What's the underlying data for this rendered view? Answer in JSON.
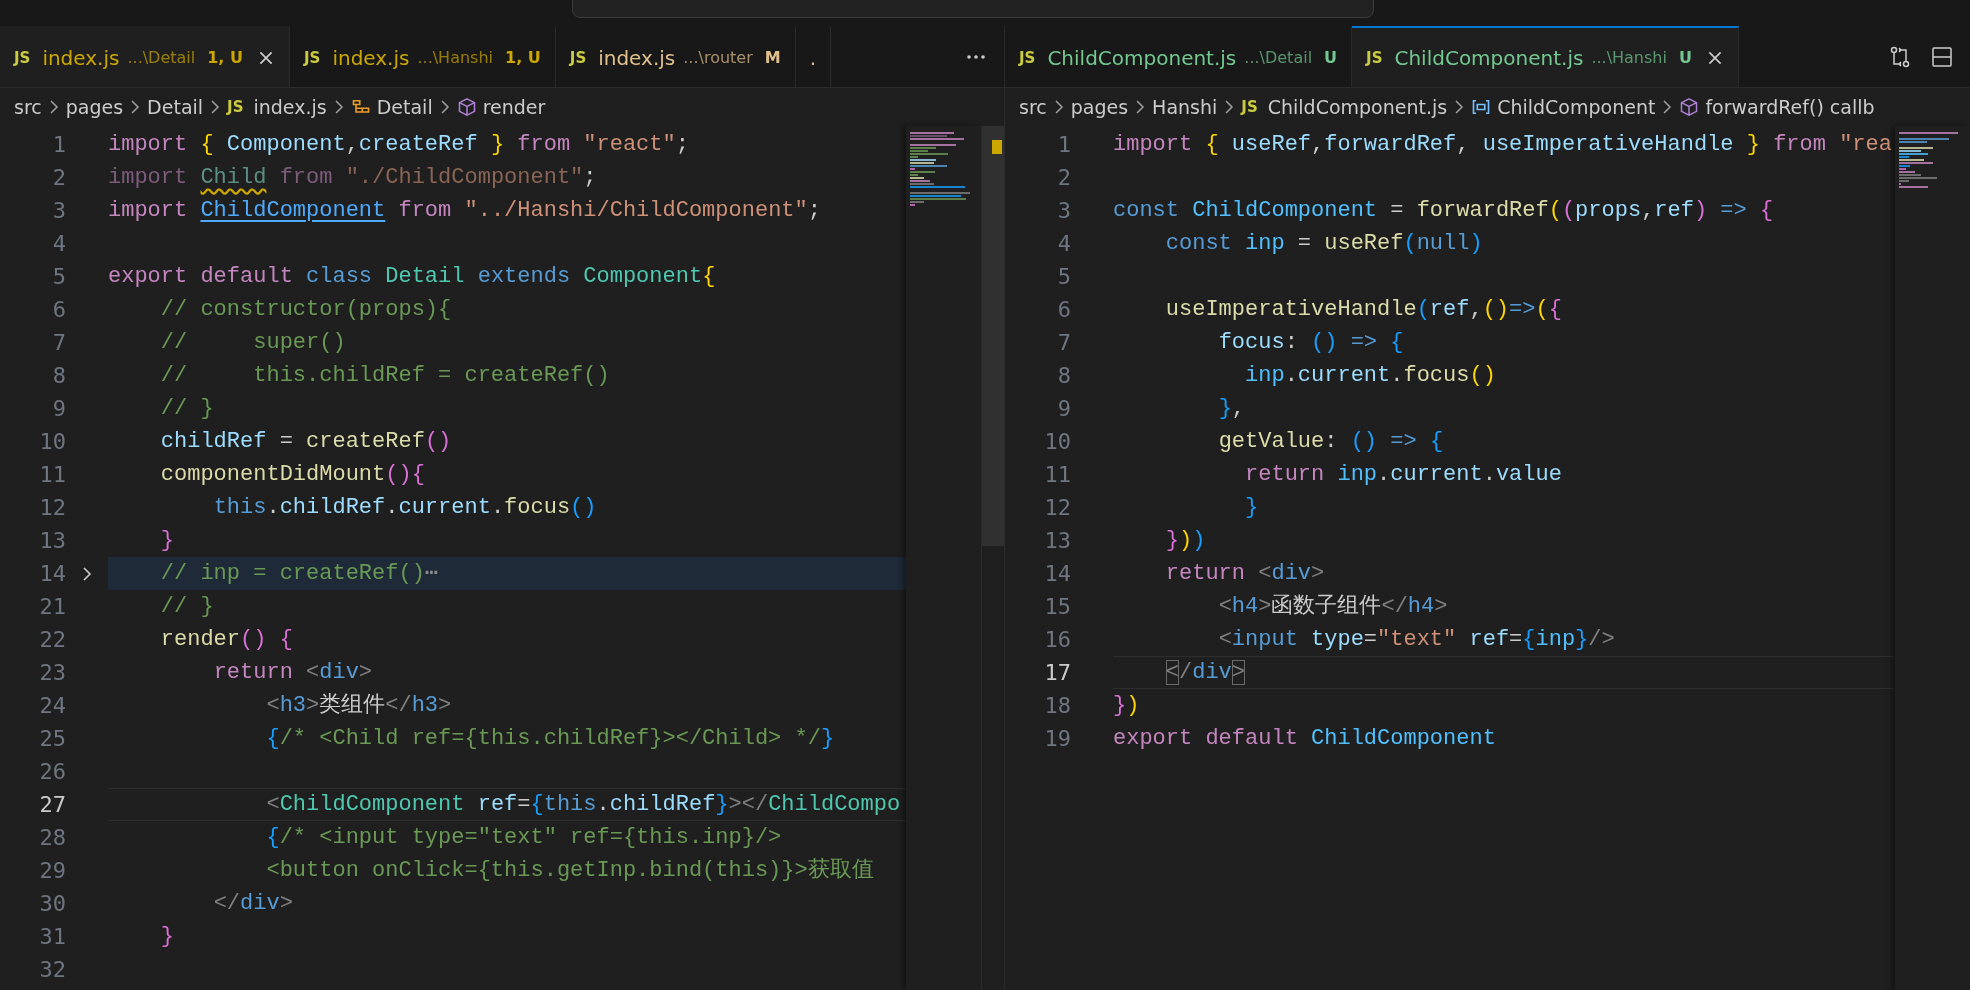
{
  "editor_groups": [
    {
      "focused": false,
      "tabs": [
        {
          "badge": "JS",
          "label": "index.js",
          "description": "...\\Detail",
          "status": "1, U",
          "kind": "warning",
          "selected": true
        },
        {
          "badge": "JS",
          "label": "index.js",
          "description": "...\\Hanshi",
          "status": "1, U",
          "kind": "warning",
          "selected": false
        },
        {
          "badge": "JS",
          "label": "index.js",
          "description": "...\\router",
          "status": "M",
          "kind": "modified",
          "selected": false
        },
        {
          "label": ".",
          "kind": "modified",
          "selected": false
        }
      ],
      "breadcrumbs": [
        {
          "kind": "folder",
          "label": "src"
        },
        {
          "kind": "folder",
          "label": "pages"
        },
        {
          "kind": "folder",
          "label": "Detail"
        },
        {
          "kind": "file",
          "badge": "JS",
          "label": "index.js"
        },
        {
          "kind": "class",
          "label": "Detail"
        },
        {
          "kind": "method",
          "label": "render"
        }
      ],
      "lines": [
        {
          "number": "1",
          "current": false,
          "folded": false,
          "tokens": [
            {
              "kind": "kw",
              "text": "import "
            },
            {
              "kind": "b1",
              "text": "{ "
            },
            {
              "kind": "va",
              "text": "Component"
            },
            {
              "kind": "p",
              "text": ","
            },
            {
              "kind": "va",
              "text": "createRef "
            },
            {
              "kind": "b1",
              "text": "} "
            },
            {
              "kind": "kw",
              "text": "from "
            },
            {
              "kind": "str",
              "text": "\"react\""
            },
            {
              "kind": "p",
              "text": ";"
            }
          ]
        },
        {
          "number": "2",
          "current": false,
          "folded": false,
          "tokens": [
            {
              "kind": "kw_dim",
              "text": "import "
            },
            {
              "kind": "ty_warn",
              "text": "Child"
            },
            {
              "kind": "kw_dim",
              "text": " from "
            },
            {
              "kind": "str_dim",
              "text": "\"./ChildComponent\""
            },
            {
              "kind": "p",
              "text": ";"
            }
          ]
        },
        {
          "number": "3",
          "current": false,
          "folded": false,
          "tokens": [
            {
              "kind": "kw",
              "text": "import "
            },
            {
              "kind": "link",
              "text": "ChildComponent"
            },
            {
              "kind": "kw",
              "text": " from "
            },
            {
              "kind": "str",
              "text": "\"../Hanshi/ChildComponent\""
            },
            {
              "kind": "p",
              "text": ";"
            }
          ]
        },
        {
          "number": "4",
          "current": false,
          "folded": false
        },
        {
          "number": "5",
          "current": false,
          "folded": false,
          "tokens": [
            {
              "kind": "kw",
              "text": "export default "
            },
            {
              "kind": "st",
              "text": "class "
            },
            {
              "kind": "ty",
              "text": "Detail "
            },
            {
              "kind": "st",
              "text": "extends "
            },
            {
              "kind": "ty",
              "text": "Component"
            },
            {
              "kind": "b1",
              "text": "{"
            }
          ]
        },
        {
          "number": "6",
          "current": false,
          "folded": false,
          "tokens": [
            {
              "kind": "cm",
              "text": "    // constructor(props){"
            }
          ]
        },
        {
          "number": "7",
          "current": false,
          "folded": false,
          "tokens": [
            {
              "kind": "cm",
              "text": "    //     super()"
            }
          ]
        },
        {
          "number": "8",
          "current": false,
          "folded": false,
          "tokens": [
            {
              "kind": "cm",
              "text": "    //     this.childRef = createRef()"
            }
          ]
        },
        {
          "number": "9",
          "current": false,
          "folded": false,
          "tokens": [
            {
              "kind": "cm",
              "text": "    // }"
            }
          ]
        },
        {
          "number": "10",
          "current": false,
          "folded": false,
          "tokens": [
            {
              "kind": "va",
              "text": "    childRef"
            },
            {
              "kind": "p",
              "text": " = "
            },
            {
              "kind": "fn",
              "text": "createRef"
            },
            {
              "kind": "b2",
              "text": "()"
            }
          ]
        },
        {
          "number": "11",
          "current": false,
          "folded": false,
          "tokens": [
            {
              "kind": "fn",
              "text": "    componentDidMount"
            },
            {
              "kind": "b2",
              "text": "(){"
            }
          ]
        },
        {
          "number": "12",
          "current": false,
          "folded": false,
          "tokens": [
            {
              "kind": "st",
              "text": "        this"
            },
            {
              "kind": "p",
              "text": "."
            },
            {
              "kind": "va",
              "text": "childRef"
            },
            {
              "kind": "p",
              "text": "."
            },
            {
              "kind": "va",
              "text": "current"
            },
            {
              "kind": "p",
              "text": "."
            },
            {
              "kind": "fn",
              "text": "focus"
            },
            {
              "kind": "b3",
              "text": "()"
            }
          ]
        },
        {
          "number": "13",
          "current": false,
          "folded": false,
          "tokens": [
            {
              "kind": "b2",
              "text": "    }"
            }
          ]
        },
        {
          "number": "14",
          "current": false,
          "folded": true,
          "tokens": [
            {
              "kind": "cm",
              "text": "    // inp = createRef()"
            },
            {
              "kind": "fold",
              "text": "⋯"
            }
          ]
        },
        {
          "number": "21",
          "current": false,
          "folded": false,
          "tokens": [
            {
              "kind": "cm",
              "text": "    // }"
            }
          ]
        },
        {
          "number": "22",
          "current": false,
          "folded": false,
          "tokens": [
            {
              "kind": "fn",
              "text": "    render"
            },
            {
              "kind": "b2",
              "text": "() "
            },
            {
              "kind": "b2",
              "text": "{"
            }
          ]
        },
        {
          "number": "23",
          "current": false,
          "folded": false,
          "tokens": [
            {
              "kind": "kw",
              "text": "        return "
            },
            {
              "kind": "tg",
              "text": "<"
            },
            {
              "kind": "tn",
              "text": "div"
            },
            {
              "kind": "tg",
              "text": ">"
            }
          ]
        },
        {
          "number": "24",
          "current": false,
          "folded": false,
          "tokens": [
            {
              "kind": "tg",
              "text": "            <"
            },
            {
              "kind": "tn",
              "text": "h3"
            },
            {
              "kind": "tg",
              "text": ">"
            },
            {
              "kind": "p",
              "text": "类组件"
            },
            {
              "kind": "tg",
              "text": "</"
            },
            {
              "kind": "tn",
              "text": "h3"
            },
            {
              "kind": "tg",
              "text": ">"
            }
          ]
        },
        {
          "number": "25",
          "current": false,
          "folded": false,
          "tokens": [
            {
              "kind": "b3",
              "text": "            {"
            },
            {
              "kind": "cm",
              "text": "/* <Child ref={this.childRef}></Child> */"
            },
            {
              "kind": "b3",
              "text": "}"
            }
          ]
        },
        {
          "number": "26",
          "current": false,
          "folded": false
        },
        {
          "number": "27",
          "current": true,
          "folded": false,
          "tokens": [
            {
              "kind": "tg",
              "text": "            <"
            },
            {
              "kind": "ty",
              "text": "ChildComponent "
            },
            {
              "kind": "va",
              "text": "ref"
            },
            {
              "kind": "p",
              "text": "="
            },
            {
              "kind": "b3",
              "text": "{"
            },
            {
              "kind": "st",
              "text": "this"
            },
            {
              "kind": "p",
              "text": "."
            },
            {
              "kind": "va",
              "text": "childRef"
            },
            {
              "kind": "b3",
              "text": "}"
            },
            {
              "kind": "tg",
              "text": "></"
            },
            {
              "kind": "ty",
              "text": "ChildCompo"
            }
          ]
        },
        {
          "number": "28",
          "current": false,
          "folded": false,
          "tokens": [
            {
              "kind": "b3",
              "text": "            {"
            },
            {
              "kind": "cm",
              "text": "/* <input type=\"text\" ref={this.inp}/>"
            }
          ]
        },
        {
          "number": "29",
          "current": false,
          "folded": false,
          "tokens": [
            {
              "kind": "cm",
              "text": "            <button onClick={this.getInp.bind(this)}>获取值"
            }
          ]
        },
        {
          "number": "30",
          "current": false,
          "folded": false,
          "tokens": [
            {
              "kind": "tg",
              "text": "        </"
            },
            {
              "kind": "tn",
              "text": "div"
            },
            {
              "kind": "tg",
              "text": ">"
            }
          ]
        },
        {
          "number": "31",
          "current": false,
          "folded": false,
          "tokens": [
            {
              "kind": "b2",
              "text": "    }"
            }
          ]
        },
        {
          "number": "32",
          "current": false,
          "folded": false
        }
      ]
    },
    {
      "focused": true,
      "tabs": [
        {
          "badge": "JS",
          "label": "ChildComponent.js",
          "description": "...\\Detail",
          "status": "U",
          "kind": "untracked",
          "selected": false
        },
        {
          "badge": "JS",
          "label": "ChildComponent.js",
          "description": "...\\Hanshi",
          "status": "U",
          "kind": "untracked",
          "selected": true
        }
      ],
      "breadcrumbs": [
        {
          "kind": "folder",
          "label": "src"
        },
        {
          "kind": "folder",
          "label": "pages"
        },
        {
          "kind": "folder",
          "label": "Hanshi"
        },
        {
          "kind": "file",
          "badge": "JS",
          "label": "ChildComponent.js"
        },
        {
          "kind": "variable",
          "label": "ChildComponent"
        },
        {
          "kind": "method",
          "label": "forwardRef() callb"
        }
      ],
      "lines": [
        {
          "number": "1",
          "current": false,
          "folded": false,
          "tokens": [
            {
              "kind": "kw",
              "text": "import "
            },
            {
              "kind": "b1",
              "text": "{ "
            },
            {
              "kind": "va",
              "text": "useRef"
            },
            {
              "kind": "p",
              "text": ","
            },
            {
              "kind": "va",
              "text": "forwardRef"
            },
            {
              "kind": "p",
              "text": ", "
            },
            {
              "kind": "va",
              "text": "useImperativeHandle "
            },
            {
              "kind": "b1",
              "text": "} "
            },
            {
              "kind": "kw",
              "text": "from "
            },
            {
              "kind": "str",
              "text": "\"rea"
            }
          ]
        },
        {
          "number": "2",
          "current": false,
          "folded": false
        },
        {
          "number": "3",
          "current": false,
          "folded": false,
          "tokens": [
            {
              "kind": "st",
              "text": "const "
            },
            {
              "kind": "co",
              "text": "ChildComponent"
            },
            {
              "kind": "p",
              "text": " = "
            },
            {
              "kind": "fn",
              "text": "forwardRef"
            },
            {
              "kind": "b1",
              "text": "("
            },
            {
              "kind": "b2",
              "text": "("
            },
            {
              "kind": "va",
              "text": "props"
            },
            {
              "kind": "p",
              "text": ","
            },
            {
              "kind": "va",
              "text": "ref"
            },
            {
              "kind": "b2",
              "text": ") "
            },
            {
              "kind": "st",
              "text": "=> "
            },
            {
              "kind": "b2",
              "text": "{"
            }
          ]
        },
        {
          "number": "4",
          "current": false,
          "folded": false,
          "tokens": [
            {
              "kind": "st",
              "text": "    const "
            },
            {
              "kind": "co",
              "text": "inp"
            },
            {
              "kind": "p",
              "text": " = "
            },
            {
              "kind": "fn",
              "text": "useRef"
            },
            {
              "kind": "b3",
              "text": "("
            },
            {
              "kind": "st",
              "text": "null"
            },
            {
              "kind": "b3",
              "text": ")"
            }
          ]
        },
        {
          "number": "5",
          "current": false,
          "folded": false
        },
        {
          "number": "6",
          "current": false,
          "folded": false,
          "tokens": [
            {
              "kind": "fn",
              "text": "    useImperativeHandle"
            },
            {
              "kind": "b3",
              "text": "("
            },
            {
              "kind": "va",
              "text": "ref"
            },
            {
              "kind": "p",
              "text": ","
            },
            {
              "kind": "b1",
              "text": "()"
            },
            {
              "kind": "st",
              "text": "=>"
            },
            {
              "kind": "b1",
              "text": "("
            },
            {
              "kind": "b2",
              "text": "{"
            }
          ]
        },
        {
          "number": "7",
          "current": false,
          "folded": false,
          "tokens": [
            {
              "kind": "va",
              "text": "        focus"
            },
            {
              "kind": "p",
              "text": ": "
            },
            {
              "kind": "b3",
              "text": "() "
            },
            {
              "kind": "st",
              "text": "=> "
            },
            {
              "kind": "b3",
              "text": "{"
            }
          ]
        },
        {
          "number": "8",
          "current": false,
          "folded": false,
          "tokens": [
            {
              "kind": "co",
              "text": "          inp"
            },
            {
              "kind": "p",
              "text": "."
            },
            {
              "kind": "va",
              "text": "current"
            },
            {
              "kind": "p",
              "text": "."
            },
            {
              "kind": "fn",
              "text": "focus"
            },
            {
              "kind": "b1",
              "text": "()"
            }
          ]
        },
        {
          "number": "9",
          "current": false,
          "folded": false,
          "tokens": [
            {
              "kind": "b3",
              "text": "        }"
            },
            {
              "kind": "p",
              "text": ","
            }
          ]
        },
        {
          "number": "10",
          "current": false,
          "folded": false,
          "tokens": [
            {
              "kind": "fn",
              "text": "        getValue"
            },
            {
              "kind": "p",
              "text": ": "
            },
            {
              "kind": "b3",
              "text": "() "
            },
            {
              "kind": "st",
              "text": "=> "
            },
            {
              "kind": "b3",
              "text": "{"
            }
          ]
        },
        {
          "number": "11",
          "current": false,
          "folded": false,
          "tokens": [
            {
              "kind": "kw",
              "text": "          return "
            },
            {
              "kind": "co",
              "text": "inp"
            },
            {
              "kind": "p",
              "text": "."
            },
            {
              "kind": "va",
              "text": "current"
            },
            {
              "kind": "p",
              "text": "."
            },
            {
              "kind": "va",
              "text": "value"
            }
          ]
        },
        {
          "number": "12",
          "current": false,
          "folded": false,
          "tokens": [
            {
              "kind": "b3",
              "text": "          }"
            }
          ]
        },
        {
          "number": "13",
          "current": false,
          "folded": false,
          "tokens": [
            {
              "kind": "b2",
              "text": "    }"
            },
            {
              "kind": "b1",
              "text": ")"
            },
            {
              "kind": "b3",
              "text": ")"
            }
          ]
        },
        {
          "number": "14",
          "current": false,
          "folded": false,
          "tokens": [
            {
              "kind": "kw",
              "text": "    return "
            },
            {
              "kind": "tg",
              "text": "<"
            },
            {
              "kind": "tn",
              "text": "div"
            },
            {
              "kind": "tg",
              "text": ">"
            }
          ]
        },
        {
          "number": "15",
          "current": false,
          "folded": false,
          "tokens": [
            {
              "kind": "tg",
              "text": "        <"
            },
            {
              "kind": "tn",
              "text": "h4"
            },
            {
              "kind": "tg",
              "text": ">"
            },
            {
              "kind": "p",
              "text": "函数子组件"
            },
            {
              "kind": "tg",
              "text": "</"
            },
            {
              "kind": "tn",
              "text": "h4"
            },
            {
              "kind": "tg",
              "text": ">"
            }
          ]
        },
        {
          "number": "16",
          "current": false,
          "folded": false,
          "tokens": [
            {
              "kind": "tg",
              "text": "        <"
            },
            {
              "kind": "tn",
              "text": "input "
            },
            {
              "kind": "va",
              "text": "type"
            },
            {
              "kind": "p",
              "text": "="
            },
            {
              "kind": "str",
              "text": "\"text\" "
            },
            {
              "kind": "va",
              "text": "ref"
            },
            {
              "kind": "p",
              "text": "="
            },
            {
              "kind": "b3",
              "text": "{"
            },
            {
              "kind": "co",
              "text": "inp"
            },
            {
              "kind": "b3",
              "text": "}"
            },
            {
              "kind": "tg",
              "text": "/>"
            }
          ]
        },
        {
          "number": "17",
          "current": true,
          "folded": false,
          "tokens": [
            {
              "kind": "tgm",
              "text": "    <"
            },
            {
              "kind": "tg",
              "text": "/"
            },
            {
              "kind": "tn",
              "text": "div"
            },
            {
              "kind": "tgm",
              "text": ">"
            }
          ]
        },
        {
          "number": "18",
          "current": false,
          "folded": false,
          "tokens": [
            {
              "kind": "b2",
              "text": "}"
            },
            {
              "kind": "b1",
              "text": ")"
            }
          ]
        },
        {
          "number": "19",
          "current": false,
          "folded": false,
          "tokens": [
            {
              "kind": "kw",
              "text": "export default "
            },
            {
              "kind": "co",
              "text": "ChildComponent"
            }
          ]
        }
      ]
    }
  ]
}
